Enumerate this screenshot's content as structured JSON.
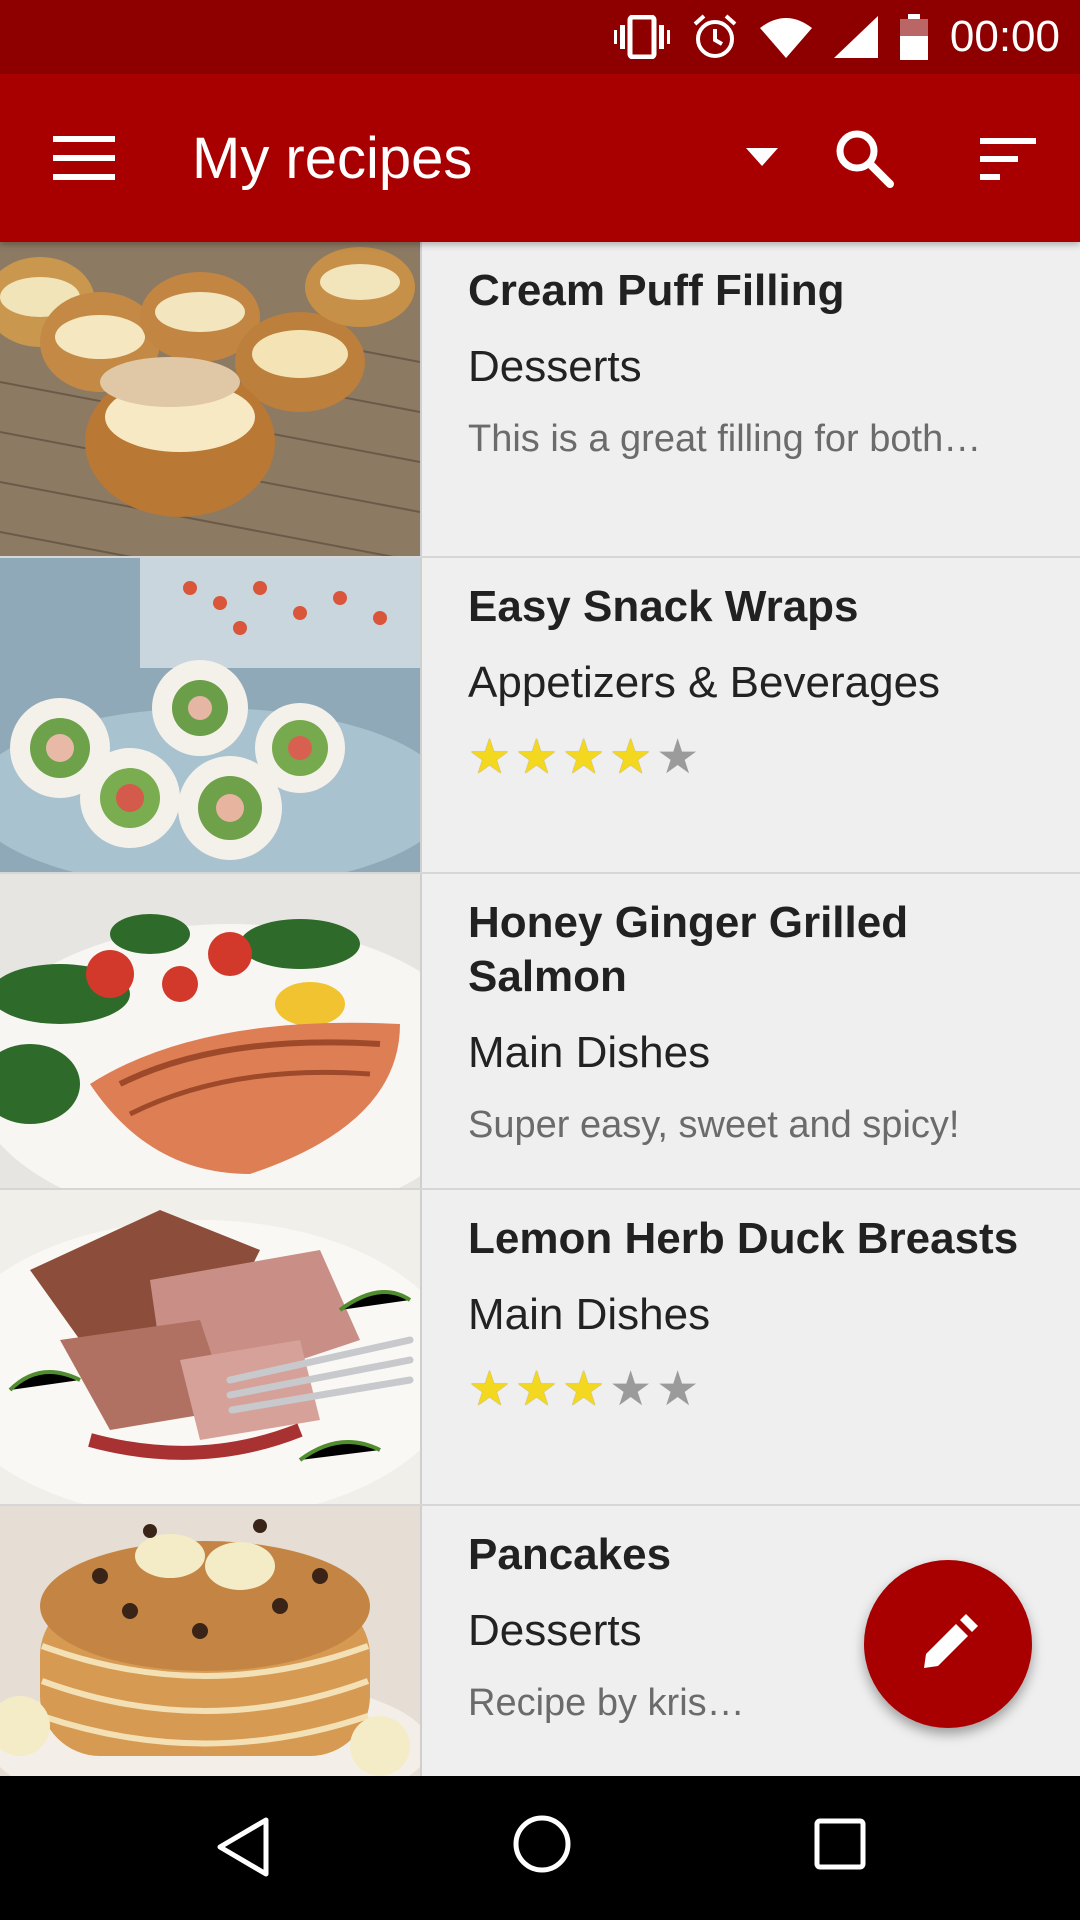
{
  "status_bar": {
    "time": "00:00",
    "icons": [
      "vibrate-icon",
      "alarm-icon",
      "wifi-icon",
      "cellular-signal-icon",
      "battery-icon"
    ]
  },
  "app_bar": {
    "title": "My recipes",
    "icons": [
      "menu-icon",
      "dropdown-arrow-icon",
      "search-icon",
      "sort-icon"
    ]
  },
  "recipes": [
    {
      "title": "Cream Puff Filling",
      "category": "Desserts",
      "description": "This is a great filling for both…"
    },
    {
      "title": "Easy Snack Wraps",
      "category": "Appetizers & Beverages",
      "rating": 4,
      "rating_max": 5
    },
    {
      "title": "Honey Ginger Grilled",
      "title_line2": "Salmon",
      "category": "Main Dishes",
      "description": "Super easy, sweet and spicy!"
    },
    {
      "title": "Lemon Herb Duck Breasts",
      "category": "Main Dishes",
      "rating": 3,
      "rating_max": 5
    },
    {
      "title": "Pancakes",
      "category": "Desserts",
      "description": "Recipe by kris…"
    }
  ],
  "fab": {
    "icon": "pencil-icon"
  },
  "nav_bar": {
    "icons": [
      "back-icon",
      "home-icon",
      "recents-icon"
    ]
  },
  "colors": {
    "status_bar": "#8e0000",
    "app_bar": "#a80000",
    "star_on": "#f4d820",
    "star_off": "#9b9b9b"
  }
}
